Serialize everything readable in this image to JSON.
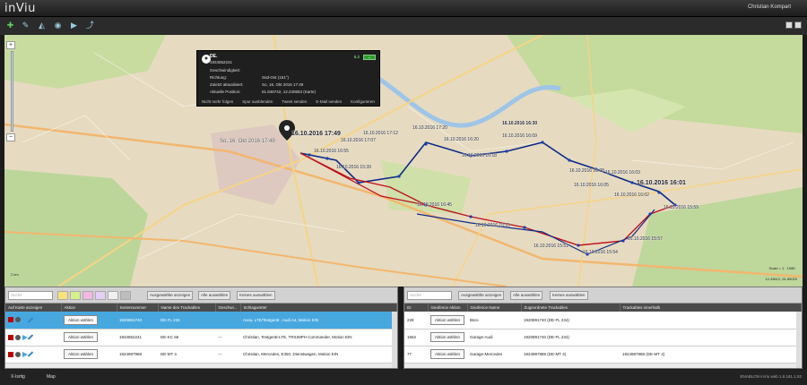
{
  "app": {
    "title": "inViu",
    "user": "Christian Kompart"
  },
  "toolbar": {
    "icons": [
      "add-icon",
      "pen-icon",
      "shape-icon",
      "eye-icon",
      "play-icon",
      "route-icon"
    ]
  },
  "popup": {
    "name": "DE.",
    "id": "1934552241",
    "signal": "5.2",
    "battery": "+",
    "rows": [
      {
        "label": "Geschwindigkeit:",
        "value": ""
      },
      {
        "label": "Richtung:",
        "value": "Süd-Ost (151°)"
      },
      {
        "label": "Zuletzt aktualisiert:",
        "value": "So, 16. Okt 2016 17:49"
      },
      {
        "label": "Aktuelle Position:",
        "value": "51.846742, 12.240653 (Karte)"
      }
    ],
    "actions": [
      "Nicht mehr folgen",
      "Spur ausblenden",
      "Tweet senden",
      "E-Mail senden",
      "Konfigurieren"
    ]
  },
  "map": {
    "marker_label": "16.10.2016 17:49",
    "marker_sub": "So, 16. Okt 2016 17:49",
    "labels": [
      "16.10.2016 17:20",
      "16.10.2016 16:20",
      "16.10.2016 17:07",
      "16.10.2016 16:55",
      "16.10.2016 15:39",
      "16.10.2016 16:45",
      "16.10.2016 16:09",
      "16.10.2016 16:08",
      "16.10.2016 16:03",
      "16.10.2016 16:01",
      "16.10.2016 15:59",
      "16.10.2016 15:57",
      "16.10.2016 15:54",
      "16.10.2016 15:51",
      "16.10.2016 16:30",
      "16.10.2016 16:18",
      "16.10.2016 17:12",
      "16.10.2016 16:05",
      "16.10.2016 16:02",
      "16.10.2016 15:25"
    ],
    "scale": "2 km",
    "scale_right": "Scale = 1 : 108K",
    "coords": "12.43612, 51.89020"
  },
  "left_panel": {
    "search_placeholder": "Suche",
    "buttons": [
      "Ausgewählte anzeigen",
      "Alle auswählen",
      "Keines auswählen"
    ],
    "columns": [
      "Auf Karte anzeigen",
      "Aktion",
      "Seriennummer",
      "Name des Trackables",
      "Geschwi...",
      "Schlagwörter"
    ],
    "rows": [
      {
        "action": "Aktion wählen",
        "serial": "1920891740",
        "name": "DE-FL 234",
        "speed": "",
        "tags": "Avea, LTE/Testgerät , Audi A4, Motion EIN"
      },
      {
        "action": "Aktion wählen",
        "serial": "1934552241",
        "name": "DE-KC 66",
        "speed": "---",
        "tags": "Christian, Testgerät-LTE, TRIUMPH Commander, Motion EIN"
      },
      {
        "action": "Aktion wählen",
        "serial": "1924987988",
        "name": "DE-MT 4",
        "speed": "---",
        "tags": "Christian, Mercedes, E350, Dienstwagen, Motion EIN"
      }
    ]
  },
  "right_panel": {
    "search_placeholder": "Suche",
    "buttons": [
      "Ausgewählte anzeigen",
      "Alle auswählen",
      "Keines auswählen"
    ],
    "columns": [
      "ID",
      "Geofence Aktion",
      "Geofence Name",
      "Zugeordnete Trackables",
      "Trackables innerhalb"
    ],
    "rows": [
      {
        "id": "228",
        "action": "Aktion wählen",
        "name": "Büro",
        "assigned": "1920891740 (DE-FL 234)",
        "inside": ""
      },
      {
        "id": "1562",
        "action": "Aktion wählen",
        "name": "Garage-Audi",
        "assigned": "1920891740 (DE-FL 234)",
        "inside": ""
      },
      {
        "id": "77",
        "action": "Aktion wählen",
        "name": "Garage-Mercedes",
        "assigned": "1924987988 (DE-MT 4)",
        "inside": "1924987988 (DE-MT 4)"
      }
    ]
  },
  "bottom": {
    "tabs": [
      "X-Isritg",
      "Map"
    ],
    "version": "ENABLON inViu web 1.6.181.1.52"
  }
}
